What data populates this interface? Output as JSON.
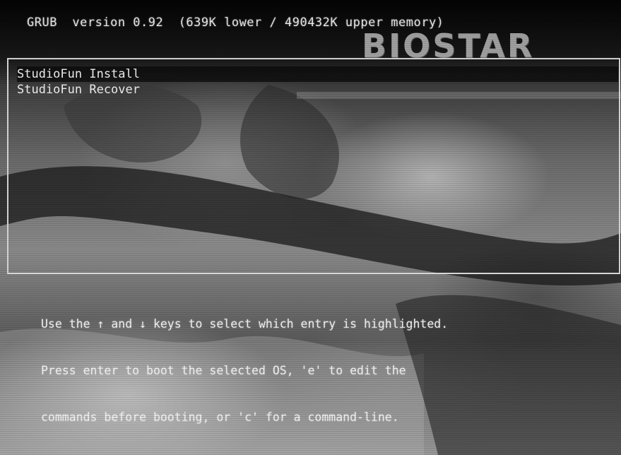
{
  "header": {
    "text": "GRUB  version 0.92  (639K lower / 490432K upper memory)"
  },
  "logo": {
    "text": "BIOSTAR"
  },
  "menu": {
    "items": [
      {
        "label": "StudioFun Install",
        "highlighted": true
      },
      {
        "label": "StudioFun Recover",
        "highlighted": false
      }
    ]
  },
  "help": {
    "lines": [
      "Use the ↑ and ↓ keys to select which entry is highlighted.",
      "Press enter to boot the selected OS, 'e' to edit the",
      "commands before booting, or 'c' for a command-line."
    ]
  },
  "colors": {
    "text": "#f0f0f0",
    "border": "#d8d8d8",
    "highlight_bg": "#0a0a0a"
  }
}
